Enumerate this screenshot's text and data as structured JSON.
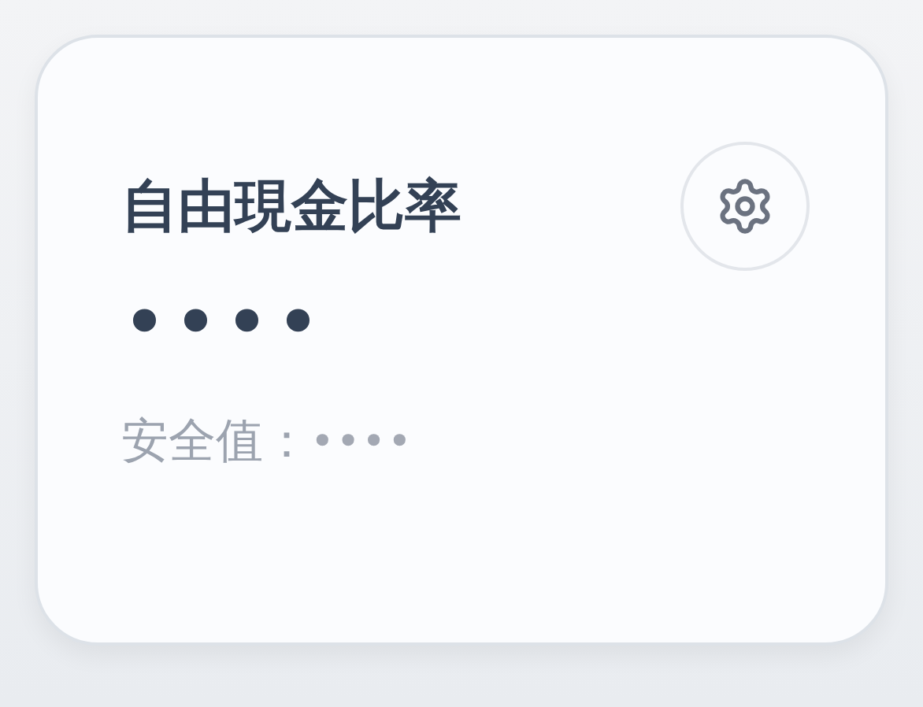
{
  "card": {
    "title": "自由現金比率",
    "value": "••••",
    "safe_label": "安全值：",
    "safe_value": "••••"
  }
}
